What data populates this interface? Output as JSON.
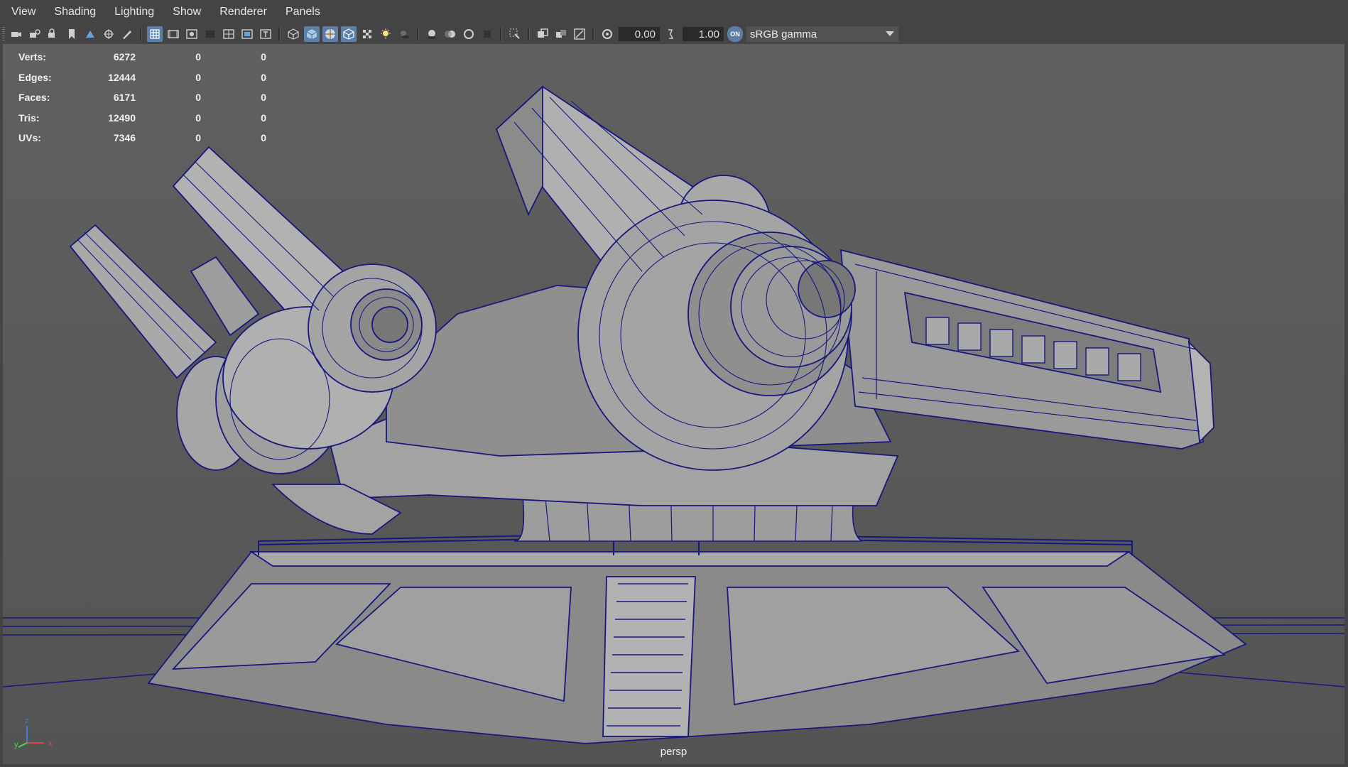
{
  "menu": {
    "items": [
      "View",
      "Shading",
      "Lighting",
      "Show",
      "Renderer",
      "Panels"
    ]
  },
  "toolbar": {
    "icons_group1": [
      "camera-icon",
      "camera-lock-icon",
      "camera-attributes-icon",
      "bookmark-icon",
      "image-plane-icon",
      "2d-pan-icon",
      "grease-pencil-icon"
    ],
    "icons_group2": [
      "grid-icon",
      "film-gate-icon",
      "resolution-gate-icon",
      "gate-mask-icon",
      "field-chart-icon",
      "safe-action-icon",
      "safe-title-icon"
    ],
    "icons_group3": [
      "wireframe-icon",
      "smooth-shade-icon",
      "wireframe-on-shaded-icon",
      "xray-icon",
      "textured-icon",
      "lights-icon",
      "shadows-icon"
    ],
    "icons_group4": [
      "ambient-occlusion-icon",
      "motion-blur-icon",
      "anti-aliasing-icon",
      "depth-of-field-icon"
    ],
    "icons_group5": [
      "isolate-select-icon"
    ],
    "icons_group6": [
      "xray-joints-icon",
      "xray-active-icon",
      "backface-icon"
    ],
    "exposure_value": "0.00",
    "gamma_value": "1.00",
    "color_mgmt_badge": "ON",
    "color_space": "sRGB gamma"
  },
  "hud": {
    "rows": [
      {
        "label": "Verts:",
        "value": "6272",
        "z1": "0",
        "z2": "0"
      },
      {
        "label": "Edges:",
        "value": "12444",
        "z1": "0",
        "z2": "0"
      },
      {
        "label": "Faces:",
        "value": "6171",
        "z1": "0",
        "z2": "0"
      },
      {
        "label": "Tris:",
        "value": "12490",
        "z1": "0",
        "z2": "0"
      },
      {
        "label": "UVs:",
        "value": "7346",
        "z1": "0",
        "z2": "0"
      }
    ]
  },
  "viewport": {
    "camera": "persp",
    "axis_labels": {
      "y": "y",
      "x": "x",
      "z": "z"
    }
  },
  "colors": {
    "background": "#444444",
    "viewport": "#5d5d5d",
    "wire": "#17177e",
    "surface": "#9c9c9c",
    "active_icon": "#5b7fa6"
  }
}
